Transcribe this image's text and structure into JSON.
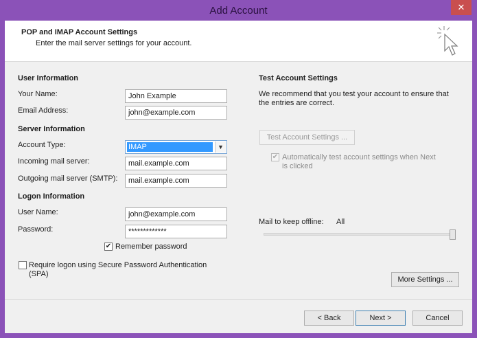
{
  "window": {
    "title": "Add Account",
    "close_glyph": "✕"
  },
  "header": {
    "title": "POP and IMAP Account Settings",
    "subtitle": "Enter the mail server settings for your account."
  },
  "user_info": {
    "heading": "User Information",
    "name_label": "Your Name:",
    "name_value": "John Example",
    "email_label": "Email Address:",
    "email_value": "john@example.com"
  },
  "server_info": {
    "heading": "Server Information",
    "account_type_label": "Account Type:",
    "account_type_value": "IMAP",
    "incoming_label": "Incoming mail server:",
    "incoming_value": "mail.example.com",
    "outgoing_label": "Outgoing mail server (SMTP):",
    "outgoing_value": "mail.example.com"
  },
  "logon_info": {
    "heading": "Logon Information",
    "username_label": "User Name:",
    "username_value": "john@example.com",
    "password_label": "Password:",
    "password_value": "*************",
    "remember_label": "Remember password",
    "remember_checked": true,
    "spa_label_line1": "Require logon using Secure Password Authentication",
    "spa_label_line2": "(SPA)",
    "spa_checked": false
  },
  "test_settings": {
    "heading": "Test Account Settings",
    "description_line1": "We recommend that you test your account to ensure that",
    "description_line2": "the entries are correct.",
    "test_button": "Test Account Settings ...",
    "auto_test_line1": "Automatically test account settings when Next",
    "auto_test_line2": "is clicked",
    "auto_test_checked": true
  },
  "offline": {
    "label": "Mail to keep offline:",
    "value": "All",
    "level_percent": 100
  },
  "buttons": {
    "more_settings": "More Settings ...",
    "back": "< Back",
    "next": "Next >",
    "cancel": "Cancel"
  },
  "icons": {
    "check": "✔",
    "dropdown": "▼"
  },
  "colors": {
    "title_bar": "#8b52b8",
    "selection": "#3399ff",
    "close": "#c94f4f"
  }
}
